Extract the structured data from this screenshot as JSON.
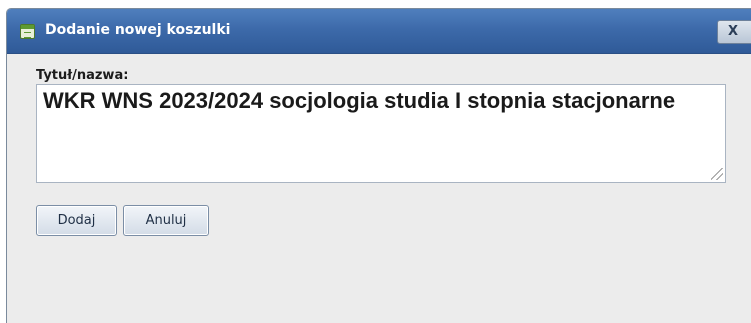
{
  "dialog": {
    "title": "Dodanie nowej koszulki",
    "close_label": "X",
    "title_icon": "form-icon"
  },
  "form": {
    "title_label": "Tytuł/nazwa:",
    "title_value": "WKR WNS 2023/2024 socjologia studia I stopnia stacjonarne"
  },
  "actions": {
    "add_label": "Dodaj",
    "cancel_label": "Anuluj"
  },
  "colors": {
    "titlebar": "#3d6aaa",
    "dialog_bg": "#ececec",
    "title_text": "#ffffff"
  }
}
